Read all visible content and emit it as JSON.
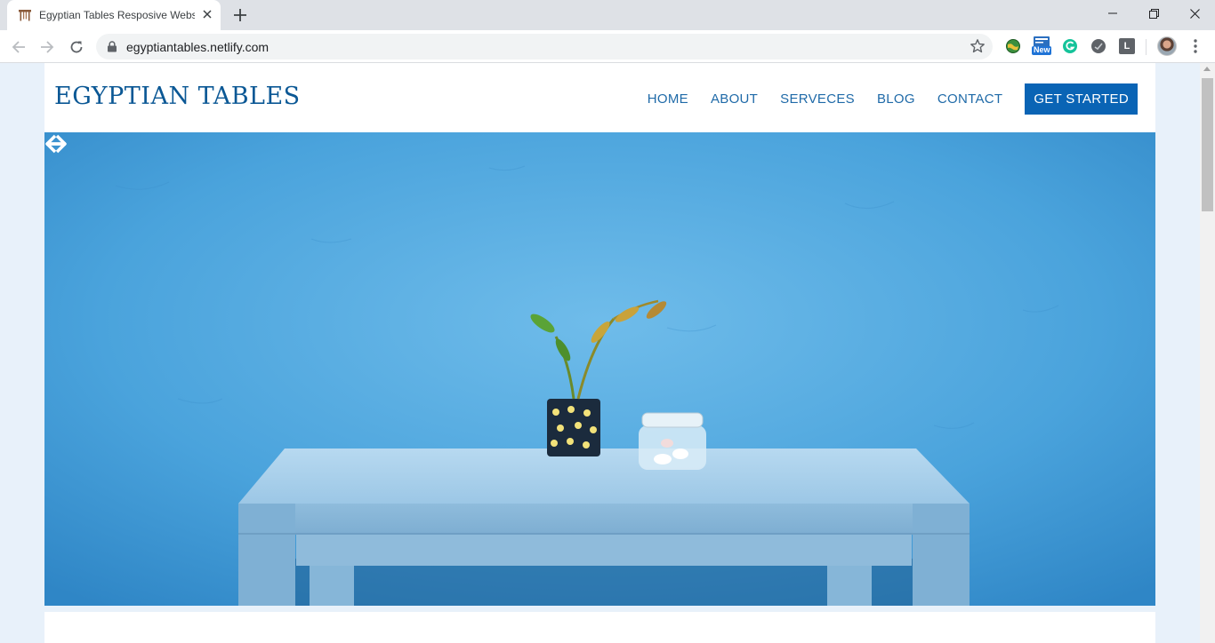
{
  "browser": {
    "tab": {
      "title": "Egyptian Tables Resposive Website",
      "favicon": "table-icon"
    },
    "window_controls": [
      "minimize-icon",
      "restore-icon",
      "close-icon"
    ],
    "address_bar": {
      "url": "egyptiantables.netlify.com",
      "secure": true
    },
    "extensions": [
      "globe-extension-icon",
      "news-extension-icon",
      "grammarly-icon",
      "dark-extension-icon",
      "l-extension-icon"
    ],
    "extension_badges": {
      "news": "New",
      "l": "L"
    }
  },
  "site": {
    "logo": "EGYPTIAN TABLES",
    "nav": {
      "home": "HOME",
      "about": "ABOUT",
      "services": "SERVECES",
      "blog": "BLOG",
      "contact": "CONTACT"
    },
    "cta": "GET STARTED",
    "hero": {
      "image_subject": "light blue table with potted plant and glass jar against blue wall",
      "prev_icon": "arrow-left-icon",
      "next_icon": "arrow-right-icon"
    },
    "colors": {
      "brand": "#0b5895",
      "nav": "#1f6aa8",
      "cta_bg": "#0a64b5",
      "page_bg": "#e8f1fa"
    }
  }
}
